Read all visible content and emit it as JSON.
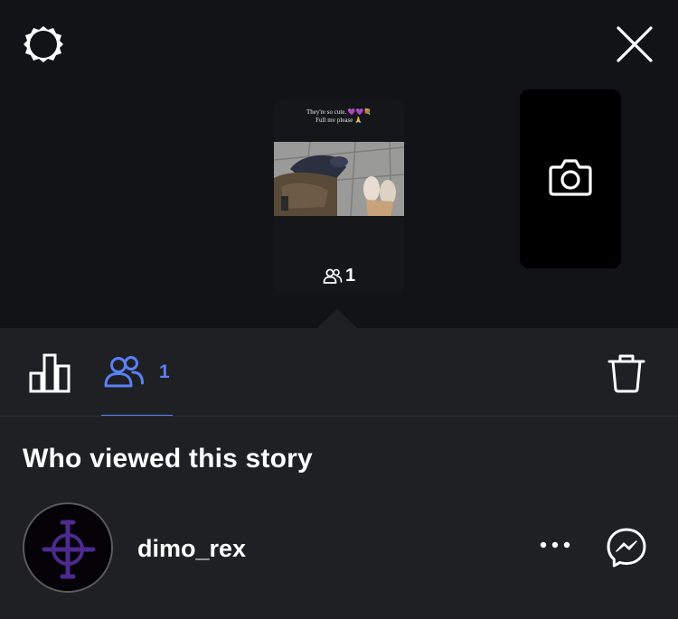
{
  "header": {
    "settings_icon": "gear-icon",
    "close_icon": "close-icon"
  },
  "story": {
    "caption_line1": "They're so cute. 💜💜💐",
    "caption_line2": "Full mv please 🙏",
    "viewer_count": "1",
    "camera_icon": "camera-icon"
  },
  "tabs": {
    "insights_icon": "bar-chart-icon",
    "viewers_icon": "people-icon",
    "viewers_count": "1",
    "delete_icon": "trash-icon",
    "accent_color": "#5b80f4"
  },
  "section": {
    "title": "Who viewed this story"
  },
  "viewers": [
    {
      "username": "dimo_rex",
      "more_icon": "more-icon",
      "message_icon": "messenger-icon"
    }
  ]
}
